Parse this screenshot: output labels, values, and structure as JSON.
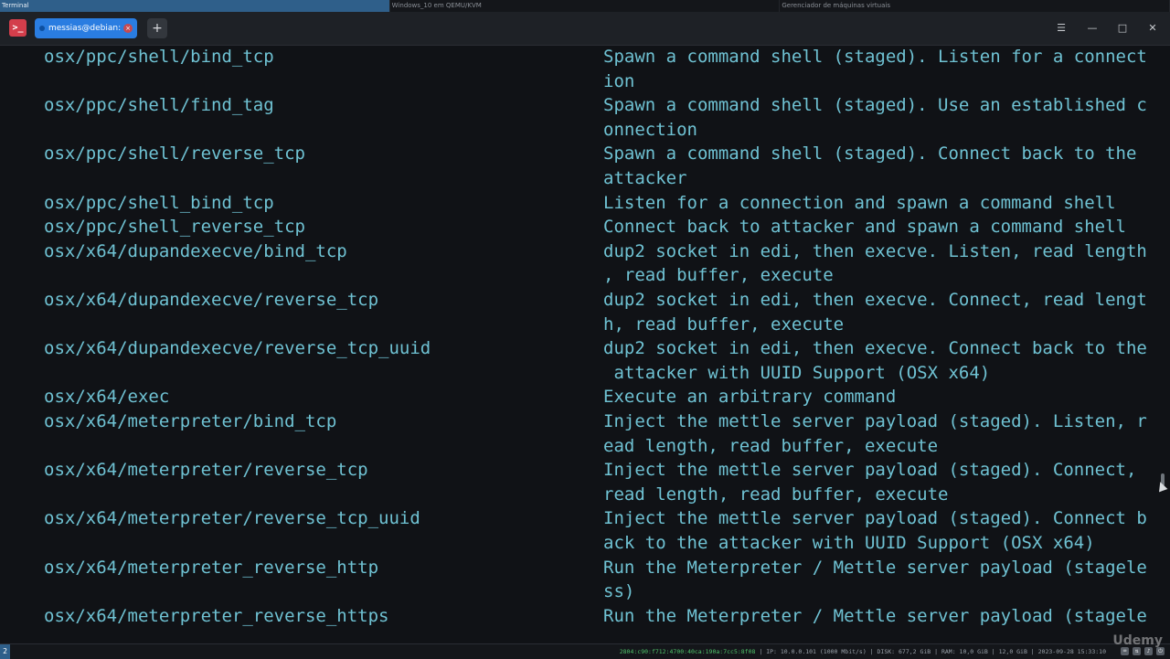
{
  "taskbar": {
    "items": [
      "Terminal",
      "Windows_10 em QEMU/KVM",
      "Gerenciador de máquinas virtuais"
    ]
  },
  "window": {
    "tab_title": "messias@debian: ~",
    "new_tab_label": "+",
    "controls": {
      "menu": "☰",
      "minimize": "—",
      "maximize": "□",
      "close": "✕"
    }
  },
  "terminal": {
    "lines": [
      {
        "name": "osx/ppc/shell/bind_tcp",
        "desc": "Spawn a command shell (staged). Listen for a connect"
      },
      {
        "name": "",
        "desc": "ion"
      },
      {
        "name": "osx/ppc/shell/find_tag",
        "desc": "Spawn a command shell (staged). Use an established c"
      },
      {
        "name": "",
        "desc": "onnection"
      },
      {
        "name": "osx/ppc/shell/reverse_tcp",
        "desc": "Spawn a command shell (staged). Connect back to the"
      },
      {
        "name": "",
        "desc": "attacker"
      },
      {
        "name": "osx/ppc/shell_bind_tcp",
        "desc": "Listen for a connection and spawn a command shell"
      },
      {
        "name": "osx/ppc/shell_reverse_tcp",
        "desc": "Connect back to attacker and spawn a command shell"
      },
      {
        "name": "osx/x64/dupandexecve/bind_tcp",
        "desc": "dup2 socket in edi, then execve. Listen, read length"
      },
      {
        "name": "",
        "desc": ", read buffer, execute"
      },
      {
        "name": "osx/x64/dupandexecve/reverse_tcp",
        "desc": "dup2 socket in edi, then execve. Connect, read lengt"
      },
      {
        "name": "",
        "desc": "h, read buffer, execute"
      },
      {
        "name": "osx/x64/dupandexecve/reverse_tcp_uuid",
        "desc": "dup2 socket in edi, then execve. Connect back to the"
      },
      {
        "name": "",
        "desc": " attacker with UUID Support (OSX x64)"
      },
      {
        "name": "osx/x64/exec",
        "desc": "Execute an arbitrary command"
      },
      {
        "name": "osx/x64/meterpreter/bind_tcp",
        "desc": "Inject the mettle server payload (staged). Listen, r"
      },
      {
        "name": "",
        "desc": "ead length, read buffer, execute"
      },
      {
        "name": "osx/x64/meterpreter/reverse_tcp",
        "desc": "Inject the mettle server payload (staged). Connect,"
      },
      {
        "name": "",
        "desc": "read length, read buffer, execute"
      },
      {
        "name": "osx/x64/meterpreter/reverse_tcp_uuid",
        "desc": "Inject the mettle server payload (staged). Connect b"
      },
      {
        "name": "",
        "desc": "ack to the attacker with UUID Support (OSX x64)"
      },
      {
        "name": "osx/x64/meterpreter_reverse_http",
        "desc": "Run the Meterpreter / Mettle server payload (stagele"
      },
      {
        "name": "",
        "desc": "ss)"
      },
      {
        "name": "osx/x64/meterpreter_reverse_https",
        "desc": "Run the Meterpreter / Mettle server payload (stagele"
      }
    ]
  },
  "statusbar": {
    "workspace": "2",
    "ipv6": "2804:c90:f712:4700:40ca:190a:7cc5:8f08",
    "ip": "IP: 10.0.0.101 (1000 Mbit/s)",
    "disk": "DISK: 677,2 GiB",
    "ram": "RAM: 10,0 GiB | 12,0 GiB",
    "datetime": "2023-09-28 15:33:10"
  },
  "watermark": "Udemy"
}
